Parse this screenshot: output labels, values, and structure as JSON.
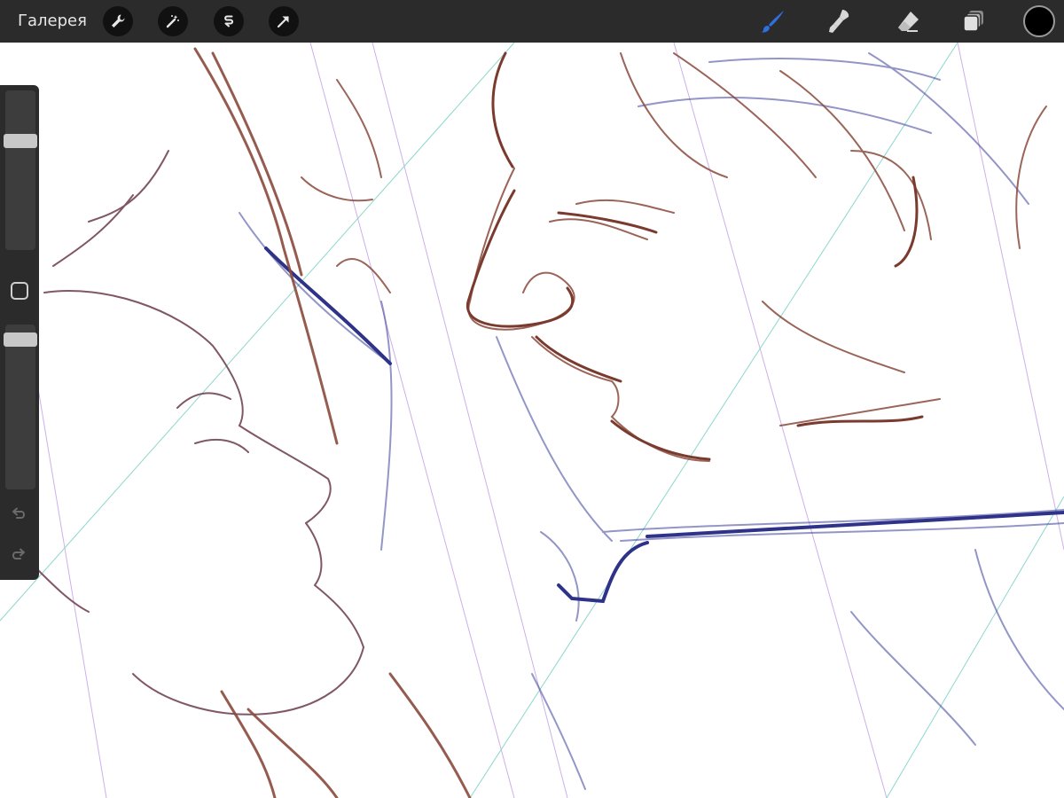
{
  "toolbar": {
    "gallery_label": "Галерея",
    "left_actions": [
      "wrench-icon",
      "magic-wand-icon",
      "selection-icon",
      "transform-arrow-icon"
    ],
    "right_tools": [
      "brush-icon",
      "smudge-icon",
      "eraser-icon",
      "layers-icon"
    ],
    "active_tool": "brush-icon",
    "active_tool_color": "#2f6fe0",
    "current_color": "#000000"
  },
  "sidebar": {
    "brush_size_level": 0.7,
    "opacity_level": 0.95,
    "modify_button": "square-icon",
    "undo": "undo-icon",
    "redo": "redo-icon"
  },
  "canvas": {
    "subject": "sketch",
    "line_colors": [
      "#8a4a3c",
      "#3b3f9a",
      "#c9a6e8",
      "#7fd3c8"
    ]
  }
}
